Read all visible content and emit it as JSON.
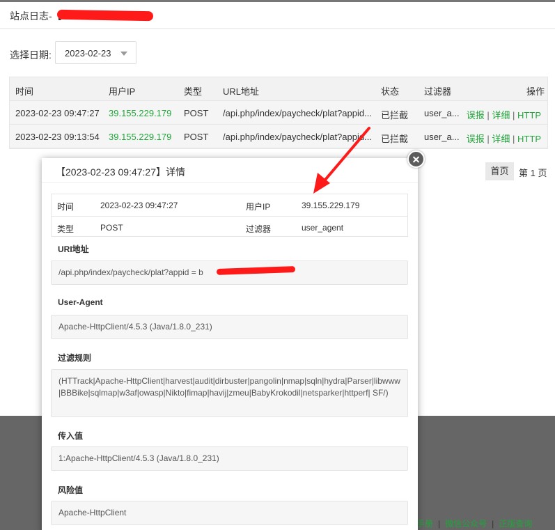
{
  "header": {
    "title": "站点日志-【"
  },
  "filter": {
    "label": "选择日期:",
    "date": "2023-02-23"
  },
  "table": {
    "columns": [
      "时间",
      "用户IP",
      "类型",
      "URL地址",
      "状态",
      "过滤器",
      "操作"
    ],
    "rows": [
      {
        "time": "2023-02-23 09:47:27",
        "ip": "39.155.229.179",
        "type": "POST",
        "url": "/api.php/index/paycheck/plat?appid...",
        "status": "已拦截",
        "filter": "user_a...",
        "op1": "误报",
        "op2": "详细",
        "op3": "HTTP"
      },
      {
        "time": "2023-02-23 09:13:54",
        "ip": "39.155.229.179",
        "type": "POST",
        "url": "/api.php/index/paycheck/plat?appid...",
        "status": "已拦截",
        "filter": "user_a...",
        "op1": "误报",
        "op2": "详细",
        "op3": "HTTP"
      }
    ],
    "op_sep": "|"
  },
  "pager": {
    "first": "首页",
    "current": "第 1 页"
  },
  "footer": {
    "links": [
      "手册",
      "微信公众号",
      "正版查询"
    ],
    "sep": "|"
  },
  "modal": {
    "title": "【2023-02-23 09:47:27】详情",
    "info": {
      "time_label": "时间",
      "time": "2023-02-23 09:47:27",
      "ip_label": "用户IP",
      "ip": "39.155.229.179",
      "type_label": "类型",
      "type": "POST",
      "filter_label": "过滤器",
      "filter": "user_agent"
    },
    "uri_label": "URI地址",
    "uri": "/api.php/index/paycheck/plat?appid = b",
    "ua_label": "User-Agent",
    "ua": "Apache-HttpClient/4.5.3 (Java/1.8.0_231)",
    "rule_label": "过滤规则",
    "rule": "(HTTrack|Apache-HttpClient|harvest|audit|dirbuster|pangolin|nmap|sqln|hydra|Parser|libwww|BBBike|sqlmap|w3af|owasp|Nikto|fimap|havij|zmeu|BabyKrokodil|netsparker|httperf| SF/)",
    "input_label": "传入值",
    "input": "1:Apache-HttpClient/4.5.3 (Java/1.8.0_231)",
    "risk_label": "风险值",
    "risk": "Apache-HttpClient"
  },
  "colors": {
    "accent": "#20a53a",
    "annotation": "#ff1a1a"
  }
}
